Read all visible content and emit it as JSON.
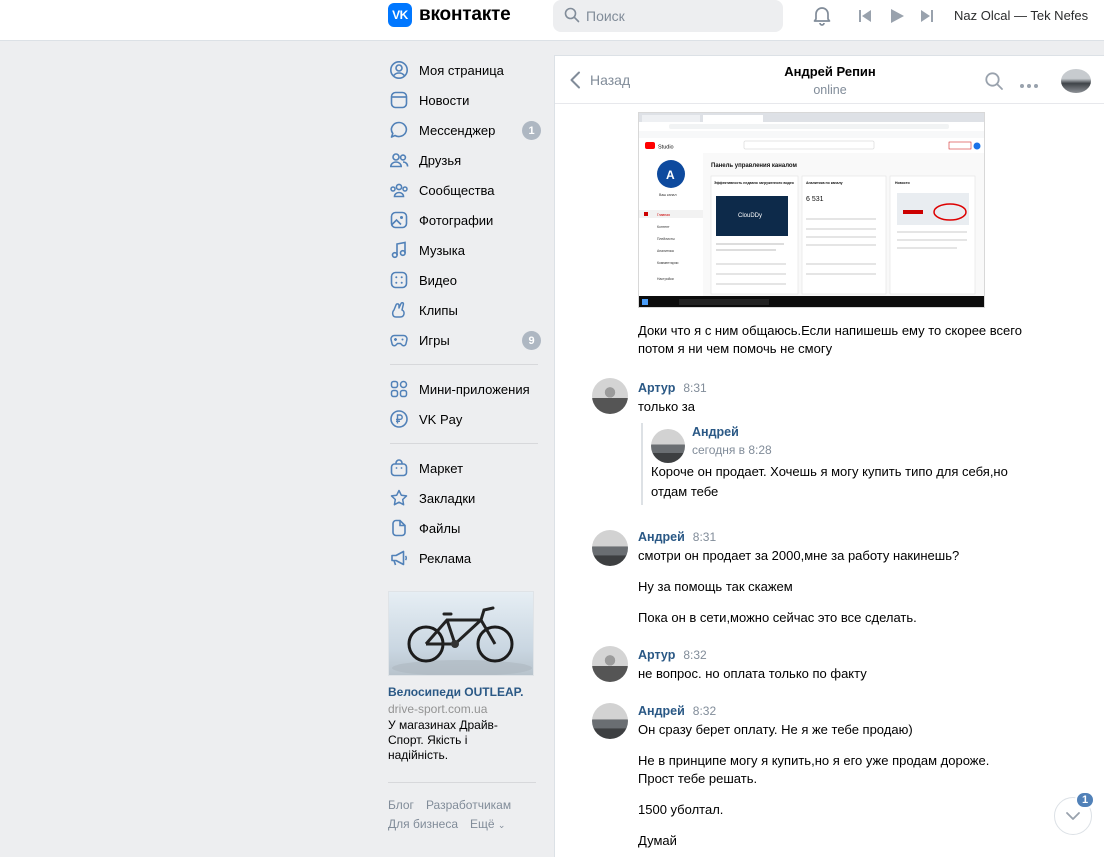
{
  "header": {
    "logo_mark": "VK",
    "logo_text": "вконтакте",
    "search_placeholder": "Поиск",
    "user_name": "Naz Olcal — Tek Nefes"
  },
  "sidebar": {
    "items": [
      {
        "label": "Моя страница",
        "icon": "user-icon"
      },
      {
        "label": "Новости",
        "icon": "news-icon"
      },
      {
        "label": "Мессенджер",
        "icon": "message-icon",
        "badge": "1"
      },
      {
        "label": "Друзья",
        "icon": "friends-icon"
      },
      {
        "label": "Сообщества",
        "icon": "groups-icon"
      },
      {
        "label": "Фотографии",
        "icon": "photo-icon"
      },
      {
        "label": "Музыка",
        "icon": "music-icon"
      },
      {
        "label": "Видео",
        "icon": "video-icon"
      },
      {
        "label": "Клипы",
        "icon": "clips-icon"
      },
      {
        "label": "Игры",
        "icon": "games-icon",
        "badge": "9"
      },
      {
        "label": "Мини-приложения",
        "icon": "apps-icon"
      },
      {
        "label": "VK Pay",
        "icon": "vkpay-icon"
      },
      {
        "label": "Маркет",
        "icon": "market-icon"
      },
      {
        "label": "Закладки",
        "icon": "bookmark-icon"
      },
      {
        "label": "Файлы",
        "icon": "files-icon"
      },
      {
        "label": "Реклама",
        "icon": "ads-icon"
      }
    ],
    "ad": {
      "title": "Велосипеди OUTLEAP.",
      "domain": "drive-sport.com.ua",
      "desc": "У магазинах Драйв-Спорт. Якість і надійність."
    },
    "footer": {
      "blog": "Блог",
      "devs": "Разработчикам",
      "business": "Для бизнеса",
      "more": "Ещё"
    }
  },
  "chat": {
    "back": "Назад",
    "peer_name": "Андрей Репин",
    "peer_status": "online",
    "screenshot": {
      "studio": "Studio",
      "panel_title": "Панель управления каналом",
      "channel_label": "Ваш канал",
      "card1": "Эффективность недавно загруженного видео",
      "card2": "Аналитика по каналу",
      "subs_value": "6 531",
      "card3": "Новости",
      "brand": "ClouDDy",
      "menu_main": "Главная",
      "menu_content": "Контент",
      "menu_playlists": "Плейлисты",
      "menu_analytics": "Аналитика",
      "menu_comments": "Комментарии",
      "menu_settings": "Настройки"
    },
    "msg1_text": "Доки что я с ним общаюсь.Если напишешь ему то скорее всего потом я ни чем помочь не смогу",
    "msg2": {
      "author": "Артур",
      "time": "8:31",
      "text": "только за"
    },
    "fwd": {
      "author": "Андрей",
      "time": "сегодня в 8:28",
      "text": "Короче он продает. Хочешь я могу купить типо для себя,но отдам тебе"
    },
    "msg3": {
      "author": "Андрей",
      "time": "8:31",
      "lines": [
        "смотри он продает за 2000,мне за работу накинешь?",
        "Ну за помощь так скажем",
        "Пока он в сети,можно сейчас это все сделать."
      ]
    },
    "msg4": {
      "author": "Артур",
      "time": "8:32",
      "text": "не вопрос. но оплата только по факту"
    },
    "msg5": {
      "author": "Андрей",
      "time": "8:32",
      "lines": [
        "Он сразу берет оплату. Не я же тебе продаю)",
        "Не в принципе могу я купить,но я его уже продам дороже. Прост тебе решать.",
        "1500 уболтал.",
        "Думай"
      ]
    },
    "unread_badge": "1"
  }
}
